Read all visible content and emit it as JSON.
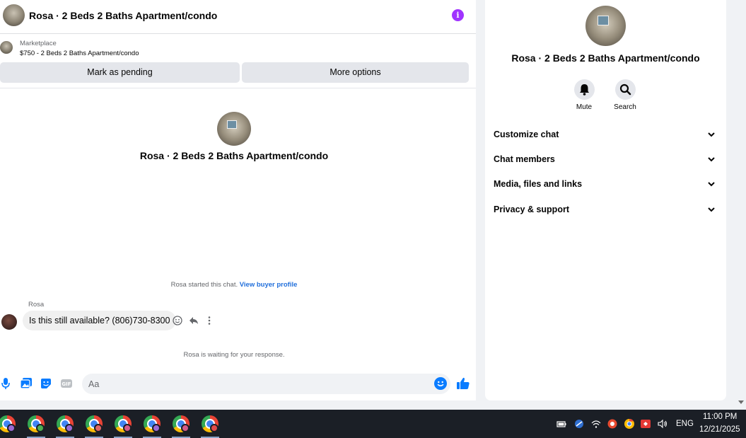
{
  "chat": {
    "header_title": "Rosa · 2 Beds 2 Baths Apartment/condo",
    "marketplace_label": "Marketplace",
    "listing_line": "$750 - 2 Beds 2 Baths Apartment/condo",
    "mark_pending_label": "Mark as pending",
    "more_options_label": "More options",
    "center_title": "Rosa · 2 Beds 2 Baths Apartment/condo",
    "started_text": "Rosa started this chat.",
    "view_profile_link": "View buyer profile",
    "sender_name": "Rosa",
    "message_text": "Is this still available? (806)730-8300",
    "waiting_text": "Rosa is waiting for your response.",
    "composer_placeholder": "Aa"
  },
  "info_panel": {
    "title": "Rosa · 2 Beds 2 Baths Apartment/condo",
    "mute_label": "Mute",
    "search_label": "Search",
    "sections": [
      {
        "label": "Customize chat"
      },
      {
        "label": "Chat members"
      },
      {
        "label": "Media, files and links"
      },
      {
        "label": "Privacy & support"
      }
    ]
  },
  "taskbar": {
    "language": "ENG",
    "time": "11:00 PM",
    "date": "12/21/2025",
    "apps": [
      {
        "icon": "chrome-profile-icon",
        "badge_color": "#9c6ad6"
      },
      {
        "icon": "chrome-profile-icon",
        "badge_color": "#4caf50"
      },
      {
        "icon": "chrome-profile-icon",
        "badge_color": "#9c6ad6"
      },
      {
        "icon": "chrome-profile-icon",
        "badge_color": "#e06666"
      },
      {
        "icon": "chrome-profile-icon",
        "badge_color": "#d45a8a"
      },
      {
        "icon": "chrome-profile-icon",
        "badge_color": "#9c6ad6"
      },
      {
        "icon": "chrome-profile-icon",
        "badge_color": "#d45a8a"
      },
      {
        "icon": "chrome-profile-icon",
        "badge_color": "#e04a4a"
      }
    ]
  },
  "colors": {
    "accent_blue": "#0a7cff",
    "info_purple": "#a033ff",
    "link_blue": "#216fdb"
  }
}
